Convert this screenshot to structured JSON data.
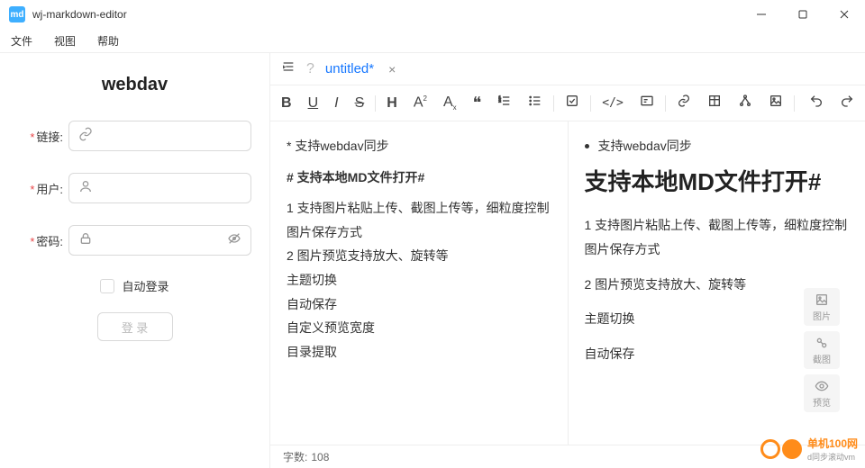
{
  "window": {
    "title": "wj-markdown-editor"
  },
  "menu": {
    "file": "文件",
    "view": "视图",
    "help": "帮助"
  },
  "sidebar": {
    "title": "webdav",
    "link_label": "链接:",
    "user_label": "用户:",
    "pass_label": "密码:",
    "auto_login": "自动登录",
    "login_btn": "登 录"
  },
  "tab": {
    "name": "untitled*",
    "q": "?",
    "close": "×"
  },
  "editor_lines": {
    "l1": "*  支持webdav同步",
    "l2": "# 支持本地MD文件打开#",
    "l3": "1  支持图片粘贴上传、截图上传等，细粒度控制图片保存方式",
    "l4": "2  图片预览支持放大、旋转等",
    "l5": "主题切换",
    "l6": "自动保存",
    "l7": "自定义预览宽度",
    "l8": "目录提取"
  },
  "preview": {
    "bullet1": "支持webdav同步",
    "h1": "支持本地MD文件打开#",
    "p1": "1 支持图片粘贴上传、截图上传等，细粒度控制图片保存方式",
    "p2": "2 图片预览支持放大、旋转等",
    "p3": "主题切换",
    "p4": "自动保存"
  },
  "status": {
    "wordcount_label": "字数:",
    "wordcount": "108"
  },
  "float": {
    "img": "图片",
    "shot": "截图",
    "preview": "预览"
  },
  "watermark": {
    "brand": "单机100网",
    "sub": "d同步滚动vm"
  },
  "colors": {
    "accent": "#1677ff",
    "required": "#e84749",
    "brand_orange": "#ff8c1a"
  }
}
